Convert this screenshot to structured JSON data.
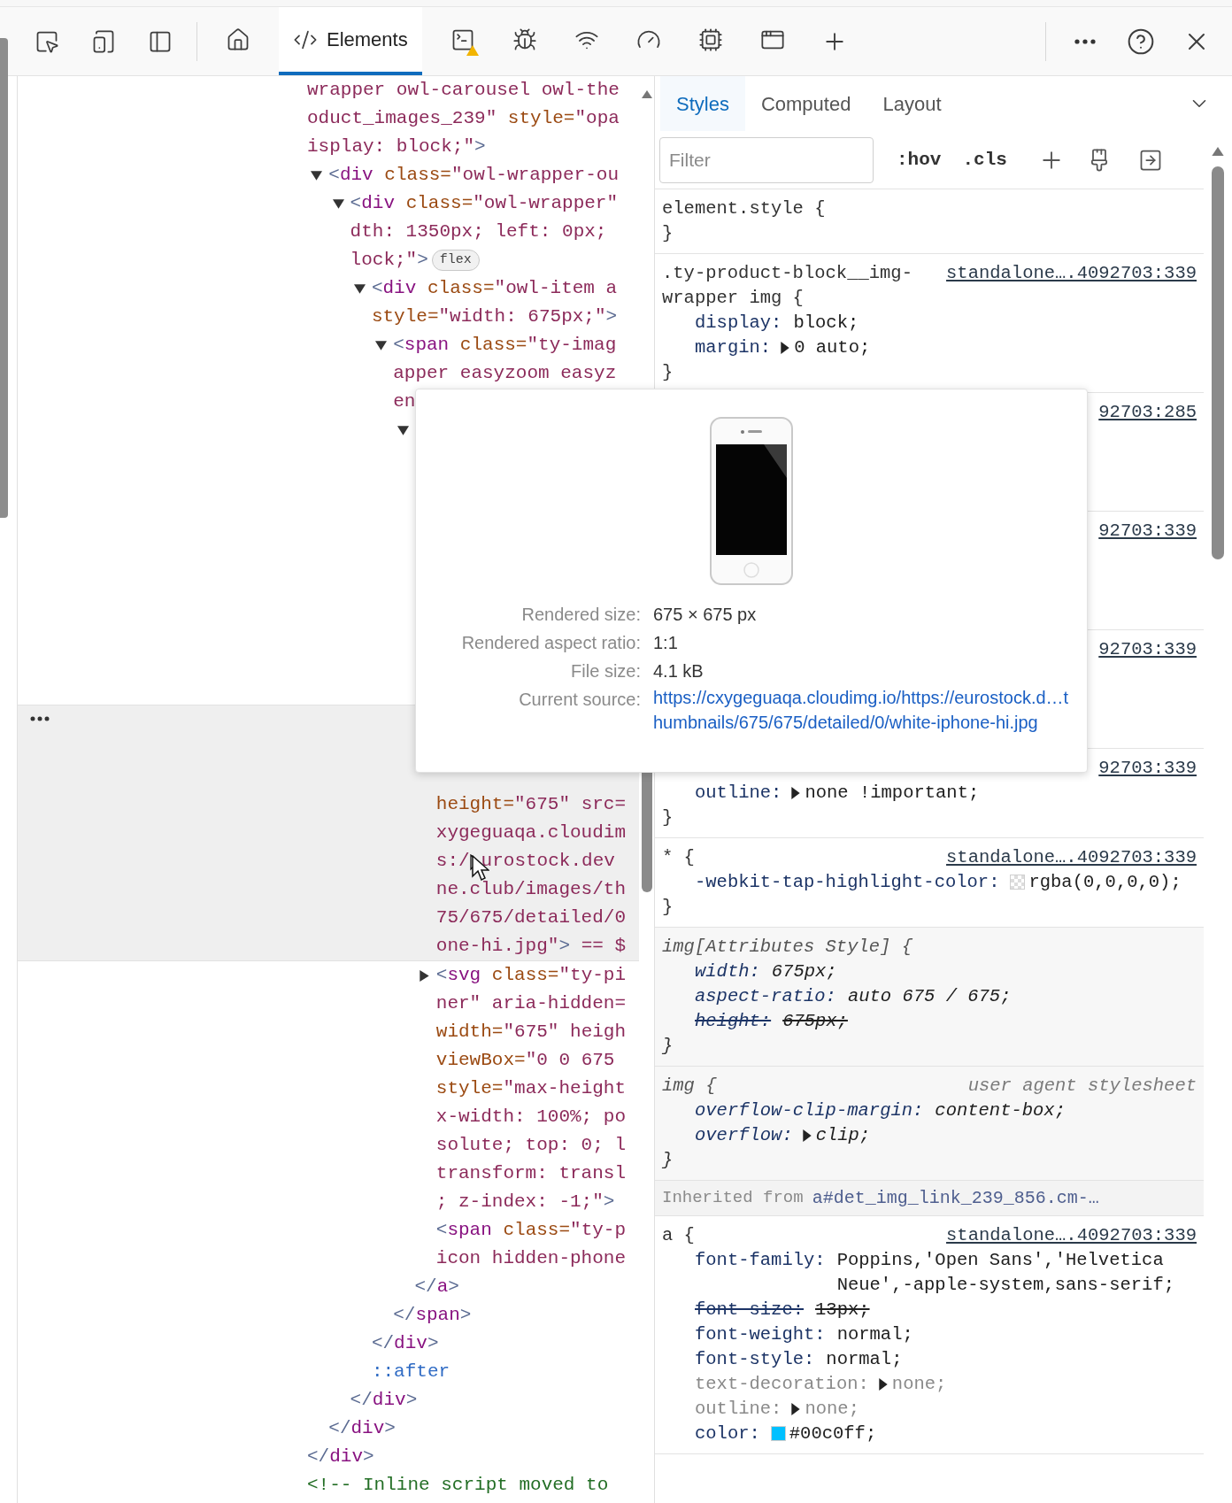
{
  "toolbar": {
    "panel_tabs": [
      {
        "selected": false,
        "warning": false
      },
      {
        "label": "Elements",
        "selected": true,
        "warning": false
      },
      {
        "selected": false,
        "warning": true
      },
      {
        "selected": false,
        "warning": false
      },
      {
        "selected": false,
        "warning": false
      },
      {
        "selected": false,
        "warning": false
      },
      {
        "selected": false,
        "warning": false
      },
      {
        "selected": false,
        "warning": false
      }
    ]
  },
  "dom_tree": [
    {
      "kind": "element",
      "selected": false,
      "lines": [
        "wrapper owl-carousel owl-the",
        "oduct_images_239\" style=\"opa",
        "isplay: block;\">"
      ],
      "closing": "</div>",
      "children": [
        {
          "kind": "element",
          "selected": false,
          "expanded": true,
          "lines": [
            "<div class=\"owl-wrapper-ou"
          ],
          "closing": "</div>",
          "children": [
            {
              "kind": "element",
              "selected": false,
              "expanded": true,
              "lines": [
                "<div class=\"owl-wrapper\"",
                "dth: 1350px; left: 0px;",
                "lock;\">"
              ],
              "badge": "flex",
              "closing": "</div>",
              "children": [
                {
                  "kind": "element",
                  "selected": false,
                  "expanded": true,
                  "lines": [
                    "<div class=\"owl-item a",
                    "style=\"width: 675px;\">"
                  ],
                  "closing": "</div>",
                  "children": [
                    {
                      "kind": "element",
                      "selected": false,
                      "expanded": true,
                      "lines": [
                        "<span class=\"ty-imag",
                        "apper easyzoom easyz",
                        "en"
                      ],
                      "closing": "</span>",
                      "children": [
                        {
                          "kind": "element",
                          "selected": false,
                          "expanded": true,
                          "closing": "</a>",
                          "children": [
                            {
                              "kind": "element",
                              "selected": true,
                              "lines": [
                                "height=\"675\" src=",
                                "xygeguaqa.cloudim",
                                [
                                  "s:/",
                                  "urostock.dev"
                                ],
                                "ne.club/images/th",
                                "75/675/detailed/0",
                                "one-hi.jpg\"> == $"
                              ]
                            },
                            {
                              "kind": "element",
                              "selected": false,
                              "expanded": false,
                              "lines": [
                                "<svg class=\"ty-pi",
                                "ner\" aria-hidden=",
                                "width=\"675\" heigh",
                                "viewBox=\"0 0 675",
                                "style=\"max-height",
                                "x-width: 100%; po",
                                "solute; top: 0; l",
                                "transform: transl",
                                "; z-index: -1;\">"
                              ]
                            },
                            {
                              "kind": "element",
                              "selected": false,
                              "lines": [
                                "<span class=\"ty-p",
                                "icon hidden-phone"
                              ]
                            }
                          ]
                        }
                      ]
                    }
                  ]
                },
                {
                  "kind": "pseudo",
                  "selected": false,
                  "lines": [
                    "::after"
                  ]
                }
              ]
            }
          ]
        }
      ]
    },
    {
      "kind": "comment",
      "selected": false,
      "lines": [
        "<!-- Inline script moved to"
      ]
    }
  ],
  "styles_pane": {
    "tabs": [
      {
        "label": "Styles",
        "selected": true
      },
      {
        "label": "Computed",
        "selected": false
      },
      {
        "label": "Layout",
        "selected": false
      }
    ],
    "filter": {
      "placeholder": "Filter"
    },
    "buttons": [
      ":hov",
      ".cls"
    ],
    "rules": [
      {
        "kind": "author",
        "selector": "element.style {",
        "closing": "}"
      },
      {
        "kind": "author",
        "selector": ".ty-product-block__img-wrapper img {",
        "source": "standalone….4092703:339",
        "closing": "}",
        "props": [
          {
            "name": "display:",
            "value": "block;",
            "overridden": false,
            "inactive": false,
            "expandable": false,
            "swatch": false
          },
          {
            "name": "margin:",
            "value": "0 auto;",
            "overridden": false,
            "inactive": false,
            "expandable": true,
            "swatch": false
          }
        ]
      },
      {
        "kind": "covered",
        "source": "92703:285"
      },
      {
        "kind": "covered",
        "source": "92703:339"
      },
      {
        "kind": "covered",
        "source": "92703:339"
      },
      {
        "kind": "author",
        "source": "92703:339",
        "closing": "}",
        "props": [
          {
            "name": "outline:",
            "value": "none !important;",
            "overridden": false,
            "inactive": false,
            "expandable": true,
            "swatch": false
          }
        ]
      },
      {
        "kind": "author",
        "selector": "* {",
        "source": "standalone….4092703:339",
        "closing": "}",
        "props": [
          {
            "name": "-webkit-tap-highlight-color:",
            "value": "rgba(0,0,0,0);",
            "overridden": false,
            "inactive": false,
            "expandable": false,
            "swatch": true
          }
        ]
      },
      {
        "kind": "attributes",
        "selector": "img[Attributes Style] {",
        "closing": "}",
        "props": [
          {
            "name": "width:",
            "value": "675px;",
            "overridden": false,
            "inactive": false,
            "expandable": false,
            "swatch": false
          },
          {
            "name": "aspect-ratio:",
            "value": "auto 675 / 675;",
            "overridden": false,
            "inactive": false,
            "expandable": false,
            "swatch": false
          },
          {
            "name": "height:",
            "value": "675px;",
            "overridden": true,
            "inactive": false,
            "expandable": false,
            "swatch": false
          }
        ]
      },
      {
        "kind": "user_agent",
        "selector": "img {",
        "source": "user agent stylesheet",
        "closing": "}",
        "props": [
          {
            "name": "overflow-clip-margin:",
            "value": "content-box;",
            "overridden": false,
            "inactive": false,
            "expandable": false,
            "swatch": false
          },
          {
            "name": "overflow:",
            "value": "clip;",
            "overridden": false,
            "inactive": false,
            "expandable": true,
            "swatch": false
          }
        ]
      },
      {
        "kind": "inherited",
        "label": "Inherited from",
        "element": "a#det_img_link_239_856.cm-…"
      },
      {
        "kind": "author",
        "selector": "a {",
        "source": "standalone….4092703:339",
        "props": [
          {
            "name": "font-family:",
            "value": "Poppins,'Open Sans','Helvetica Neue',-apple-system,sans-serif;",
            "overridden": false,
            "inactive": false,
            "expandable": false,
            "swatch": false
          },
          {
            "name": "font-size:",
            "value": "13px;",
            "overridden": true,
            "inactive": false,
            "expandable": false,
            "swatch": false
          },
          {
            "name": "font-weight:",
            "value": "normal;",
            "overridden": false,
            "inactive": false,
            "expandable": false,
            "swatch": false
          },
          {
            "name": "font-style:",
            "value": "normal;",
            "overridden": false,
            "inactive": false,
            "expandable": false,
            "swatch": false
          },
          {
            "name": "text-decoration:",
            "value": "none;",
            "overridden": false,
            "inactive": true,
            "expandable": true,
            "swatch": false
          },
          {
            "name": "outline:",
            "value": "none;",
            "overridden": false,
            "inactive": true,
            "expandable": true,
            "swatch": false
          },
          {
            "name": "color:",
            "value": "#00c0ff;",
            "overridden": false,
            "inactive": false,
            "expandable": false,
            "swatch": true
          }
        ]
      }
    ]
  },
  "image_tooltip": {
    "rows": [
      {
        "kind": "text",
        "label": "Rendered size:",
        "value": "675 × 675 px"
      },
      {
        "kind": "text",
        "label": "Rendered aspect ratio:",
        "value": "1:1"
      },
      {
        "kind": "text",
        "label": "File size:",
        "value": "4.1 kB"
      },
      {
        "kind": "link",
        "label": "Current source:",
        "value": "https://cxygeguaqa.cloudimg.io/https://eurostock.d…thumbnails/675/675/detailed/0/white-iphone-hi.jpg"
      }
    ]
  }
}
